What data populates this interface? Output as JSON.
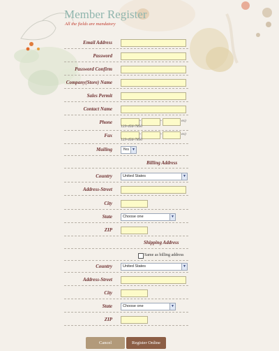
{
  "header": {
    "title": "Member Register",
    "subtitle": "All the fields are mandatory"
  },
  "form": {
    "email_label": "Email Address",
    "password_label": "Password",
    "password_confirm_label": "Password Confirm",
    "company_label": "Company(Store) Name",
    "sales_permit_label": "Sales Permit",
    "contact_name_label": "Contact Name",
    "phone_label": "Phone",
    "phone_ext": "ex)",
    "phone_hint": "123-456-7890",
    "fax_label": "Fax",
    "fax_ext": "ex)",
    "fax_hint": "123-456-7890",
    "mailing_label": "Mailing",
    "mailing_value": "Yes",
    "dash": "-"
  },
  "billing": {
    "heading": "Billing Address",
    "country_label": "Country",
    "country_value": "United States",
    "street_label": "Address-Street",
    "city_label": "City",
    "state_label": "State",
    "state_value": "Choose one",
    "zip_label": "ZIP"
  },
  "shipping": {
    "heading": "Shipping Address",
    "same_label": "Same as billing address",
    "country_label": "Country",
    "country_value": "United States",
    "street_label": "Address-Street",
    "city_label": "City",
    "state_label": "State",
    "state_value": "Choose one",
    "zip_label": "ZIP"
  },
  "buttons": {
    "cancel": "Cancel",
    "register": "Register Online"
  },
  "colors": {
    "title": "#8fb5ad",
    "label": "#6e2f2f",
    "input_bg": "#fdfbc9",
    "cancel_bg": "#b29a7a",
    "register_bg": "#8c5e45"
  }
}
